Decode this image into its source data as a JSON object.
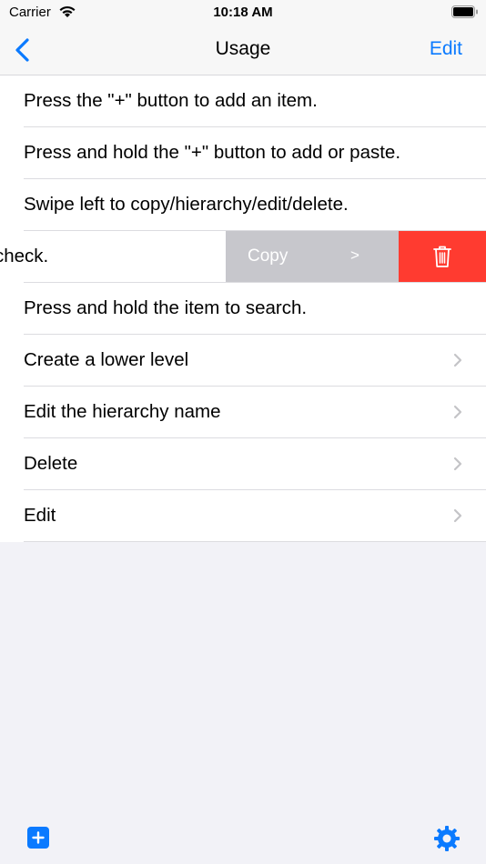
{
  "status_bar": {
    "carrier": "Carrier",
    "time": "10:18 AM",
    "wifi_icon": "wifi-icon",
    "battery_icon": "battery-icon"
  },
  "nav": {
    "back_icon": "chevron-left-icon",
    "title": "Usage",
    "edit_label": "Edit"
  },
  "rows": [
    {
      "label": "Press the \"+\" button to add an item.",
      "chevron": false
    },
    {
      "label": "Press and hold the \"+\" button to add or paste.",
      "chevron": false
    },
    {
      "label": "Swipe left to copy/hierarchy/edit/delete.",
      "chevron": false
    },
    {
      "label": "check.",
      "chevron": false,
      "swiped": true
    },
    {
      "label": "Press and hold the item to search.",
      "chevron": false
    },
    {
      "label": "Create a lower level",
      "chevron": true
    },
    {
      "label": "Edit the hierarchy name",
      "chevron": true
    },
    {
      "label": "Delete",
      "chevron": true
    },
    {
      "label": "Edit",
      "chevron": true
    }
  ],
  "swipe_actions": {
    "copy_label": "Copy",
    "hierarchy_label": ">",
    "delete_icon": "trash-icon"
  },
  "toolbar": {
    "add_icon": "plus-square-icon",
    "settings_icon": "gear-icon"
  },
  "colors": {
    "accent": "#0a7aff",
    "delete": "#ff3b30",
    "copy_action": "#c7c7cc",
    "background": "#f2f2f7"
  }
}
